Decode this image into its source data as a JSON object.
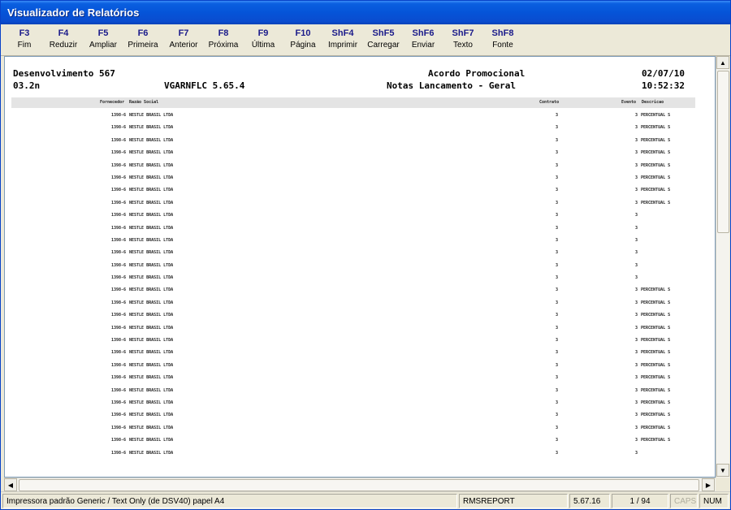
{
  "window": {
    "title": "Visualizador de Relatórios"
  },
  "toolbar": [
    {
      "key": "F3",
      "label": "Fim"
    },
    {
      "key": "F4",
      "label": "Reduzir"
    },
    {
      "key": "F5",
      "label": "Ampliar"
    },
    {
      "key": "F6",
      "label": "Primeira"
    },
    {
      "key": "F7",
      "label": "Anterior"
    },
    {
      "key": "F8",
      "label": "Próxima"
    },
    {
      "key": "F9",
      "label": "Última"
    },
    {
      "key": "F10",
      "label": "Página"
    },
    {
      "key": "ShF4",
      "label": "Imprimir"
    },
    {
      "key": "ShF5",
      "label": "Carregar"
    },
    {
      "key": "ShF6",
      "label": "Enviar"
    },
    {
      "key": "ShF7",
      "label": "Texto"
    },
    {
      "key": "ShF8",
      "label": "Fonte"
    }
  ],
  "report": {
    "company": "Desenvolvimento 567",
    "code": "03.2n",
    "program": "VGARNFLC 5.65.4",
    "title": "Acordo Promocional",
    "subtitle": "Notas Lancamento - Geral",
    "date": "02/07/10",
    "time": "10:52:32",
    "columns": {
      "fornecedor": "Fornecedor",
      "razao": "Razão Social",
      "contrato": "Contrato",
      "evento": "Evento",
      "descricao": "Descricao"
    },
    "rows": [
      {
        "fornecedor": "1398-6",
        "razao": "NESTLE BRASIL LTDA",
        "contrato": "3",
        "evento": "3",
        "descricao": "PERCENTUAL S"
      },
      {
        "fornecedor": "1398-6",
        "razao": "NESTLE BRASIL LTDA",
        "contrato": "3",
        "evento": "3",
        "descricao": "PERCENTUAL S"
      },
      {
        "fornecedor": "1398-6",
        "razao": "NESTLE BRASIL LTDA",
        "contrato": "3",
        "evento": "3",
        "descricao": "PERCENTUAL S"
      },
      {
        "fornecedor": "1398-6",
        "razao": "NESTLE BRASIL LTDA",
        "contrato": "3",
        "evento": "3",
        "descricao": "PERCENTUAL S"
      },
      {
        "fornecedor": "1398-6",
        "razao": "NESTLE BRASIL LTDA",
        "contrato": "3",
        "evento": "3",
        "descricao": "PERCENTUAL S"
      },
      {
        "fornecedor": "1398-6",
        "razao": "NESTLE BRASIL LTDA",
        "contrato": "3",
        "evento": "3",
        "descricao": "PERCENTUAL S"
      },
      {
        "fornecedor": "1398-6",
        "razao": "NESTLE BRASIL LTDA",
        "contrato": "3",
        "evento": "3",
        "descricao": "PERCENTUAL S"
      },
      {
        "fornecedor": "1398-6",
        "razao": "NESTLE BRASIL LTDA",
        "contrato": "3",
        "evento": "3",
        "descricao": "PERCENTUAL S"
      },
      {
        "fornecedor": "1398-6",
        "razao": "NESTLE BRASIL LTDA",
        "contrato": "3",
        "evento": "3",
        "descricao": ""
      },
      {
        "fornecedor": "1398-6",
        "razao": "NESTLE BRASIL LTDA",
        "contrato": "3",
        "evento": "3",
        "descricao": ""
      },
      {
        "fornecedor": "1398-6",
        "razao": "NESTLE BRASIL LTDA",
        "contrato": "3",
        "evento": "3",
        "descricao": ""
      },
      {
        "fornecedor": "1398-6",
        "razao": "NESTLE BRASIL LTDA",
        "contrato": "3",
        "evento": "3",
        "descricao": ""
      },
      {
        "fornecedor": "1398-6",
        "razao": "NESTLE BRASIL LTDA",
        "contrato": "3",
        "evento": "3",
        "descricao": ""
      },
      {
        "fornecedor": "1398-6",
        "razao": "NESTLE BRASIL LTDA",
        "contrato": "3",
        "evento": "3",
        "descricao": ""
      },
      {
        "fornecedor": "1398-6",
        "razao": "NESTLE BRASIL LTDA",
        "contrato": "3",
        "evento": "3",
        "descricao": "PERCENTUAL S"
      },
      {
        "fornecedor": "1398-6",
        "razao": "NESTLE BRASIL LTDA",
        "contrato": "3",
        "evento": "3",
        "descricao": "PERCENTUAL S"
      },
      {
        "fornecedor": "1398-6",
        "razao": "NESTLE BRASIL LTDA",
        "contrato": "3",
        "evento": "3",
        "descricao": "PERCENTUAL S"
      },
      {
        "fornecedor": "1398-6",
        "razao": "NESTLE BRASIL LTDA",
        "contrato": "3",
        "evento": "3",
        "descricao": "PERCENTUAL S"
      },
      {
        "fornecedor": "1398-6",
        "razao": "NESTLE BRASIL LTDA",
        "contrato": "3",
        "evento": "3",
        "descricao": "PERCENTUAL S"
      },
      {
        "fornecedor": "1398-6",
        "razao": "NESTLE BRASIL LTDA",
        "contrato": "3",
        "evento": "3",
        "descricao": "PERCENTUAL S"
      },
      {
        "fornecedor": "1398-6",
        "razao": "NESTLE BRASIL LTDA",
        "contrato": "3",
        "evento": "3",
        "descricao": "PERCENTUAL S"
      },
      {
        "fornecedor": "1398-6",
        "razao": "NESTLE BRASIL LTDA",
        "contrato": "3",
        "evento": "3",
        "descricao": "PERCENTUAL S"
      },
      {
        "fornecedor": "1398-6",
        "razao": "NESTLE BRASIL LTDA",
        "contrato": "3",
        "evento": "3",
        "descricao": "PERCENTUAL S"
      },
      {
        "fornecedor": "1398-6",
        "razao": "NESTLE BRASIL LTDA",
        "contrato": "3",
        "evento": "3",
        "descricao": "PERCENTUAL S"
      },
      {
        "fornecedor": "1398-6",
        "razao": "NESTLE BRASIL LTDA",
        "contrato": "3",
        "evento": "3",
        "descricao": "PERCENTUAL S"
      },
      {
        "fornecedor": "1398-6",
        "razao": "NESTLE BRASIL LTDA",
        "contrato": "3",
        "evento": "3",
        "descricao": "PERCENTUAL S"
      },
      {
        "fornecedor": "1398-6",
        "razao": "NESTLE BRASIL LTDA",
        "contrato": "3",
        "evento": "3",
        "descricao": "PERCENTUAL S"
      },
      {
        "fornecedor": "1398-6",
        "razao": "NESTLE BRASIL LTDA",
        "contrato": "3",
        "evento": "3",
        "descricao": ""
      }
    ]
  },
  "statusbar": {
    "printer": "Impressora padrão Generic / Text Only (de DSV40) papel A4",
    "app": "RMSREPORT",
    "version": "5.67.16",
    "pages": "1 / 94",
    "caps": "CAPS",
    "num": "NUM"
  },
  "colors": {
    "titlebar": "#0554d8",
    "toolbar_key": "#1a1a8a",
    "column_header_bg": "#e4e4e4"
  }
}
